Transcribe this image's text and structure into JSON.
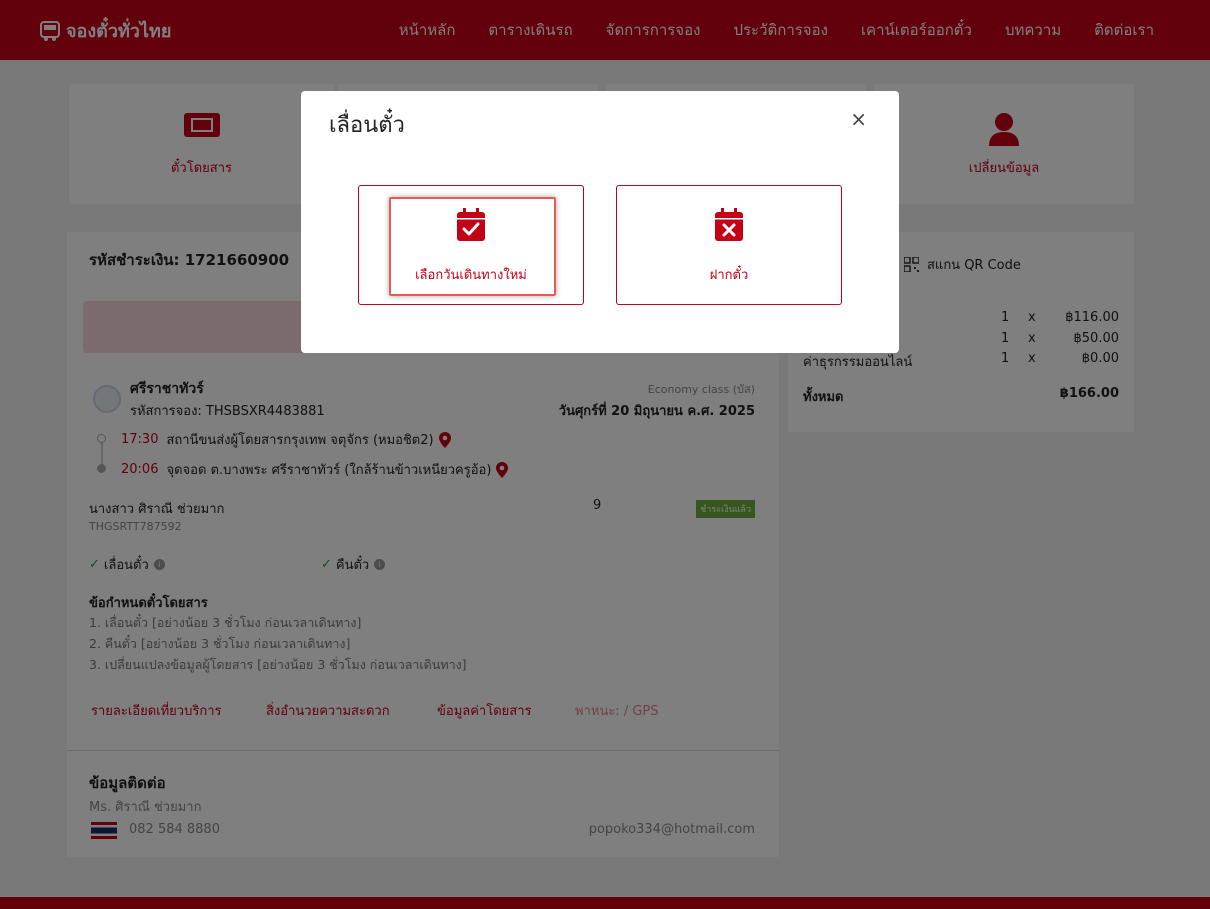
{
  "header": {
    "logo_text": "จองตั๋วทั่วไทย",
    "nav": [
      "หน้าหลัก",
      "ตารางเดินรถ",
      "จัดการการจอง",
      "ประวัติการจอง",
      "เคาน์เตอร์ออกตั๋ว",
      "บทความ",
      "ติดต่อเรา"
    ]
  },
  "cards": {
    "ticket_label": "ตั๋วโดยสาร",
    "change_info_label": "เปลี่ยนข้อมูล"
  },
  "booking": {
    "payment_code_label": "รหัสชำระเงิน: 1721660900",
    "operator_name": "ศรีราชาทัวร์",
    "booking_code": "รหัสการจอง: THSBSXR4483881",
    "class_label": "Economy class (บัส)",
    "trip_date": "วันศุกร์ที่ 20 มิถุนายน ค.ศ. 2025",
    "stops": [
      {
        "time": "17:30",
        "name": "สถานีขนส่งผู้โดยสารกรุงเทพ จตุจักร (หมอชิต2)"
      },
      {
        "time": "20:06",
        "name": "จุดจอด ต.บางพระ ศรีราชาทัวร์ (ใกล้ร้านข้าวเหนียวครูอ้อ)"
      }
    ],
    "passenger_name": "นางสาว ศิราณี ช่วยมาก",
    "ticket_no": "THGSRTT787592",
    "seat": "9",
    "paid_badge": "ชำระเงินแล้ว",
    "perm_postpone": "เลื่อนตั๋ว",
    "perm_refund": "คืนตั๋ว",
    "rules_title": "ข้อกำหนดตั๋วโดยสาร",
    "rules": [
      "1. เลื่อนตั๋ว [อย่างน้อย 3 ชั่วโมง ก่อนเวลาเดินทาง]",
      "2. คืนตั๋ว [อย่างน้อย 3 ชั่วโมง ก่อนเวลาเดินทาง]",
      "3. เปลี่ยนแปลงข้อมูลผู้โดยสาร [อย่างน้อย 3 ชั่วโมง ก่อนเวลาเดินทาง]"
    ],
    "links": [
      "รายละเอียดเที่ยวบริการ",
      "สิ่งอำนวยความสะดวก",
      "ข้อมูลค่าโดยสาร",
      "พาหนะ: / GPS"
    ]
  },
  "contact": {
    "title": "ข้อมูลติดต่อ",
    "name": "Ms. ศิราณี ช่วยมาก",
    "phone": "082 584 8880",
    "email": "popoko334@hotmail.com"
  },
  "summary": {
    "qr_label": "สแกน QR Code",
    "rows": [
      {
        "label": "",
        "qty": "1",
        "x": "x",
        "amount": "฿116.00"
      },
      {
        "label": "",
        "qty": "1",
        "x": "x",
        "amount": "฿50.00"
      },
      {
        "label": "ค่าธุรกรรมออนไลน์",
        "qty": "1",
        "x": "x",
        "amount": "฿0.00"
      }
    ],
    "total_label": "ทั้งหมด",
    "total_amount": "฿166.00"
  },
  "modal": {
    "title": "เลื่อนตั๋ว",
    "close": "×",
    "option_new_date": "เลือกวันเดินทางใหม่",
    "option_deposit": "ฝากตั๋ว"
  },
  "colors": {
    "brand_red": "#c40016",
    "paid_green": "#6cae3d",
    "highlight": "#e85a55"
  }
}
